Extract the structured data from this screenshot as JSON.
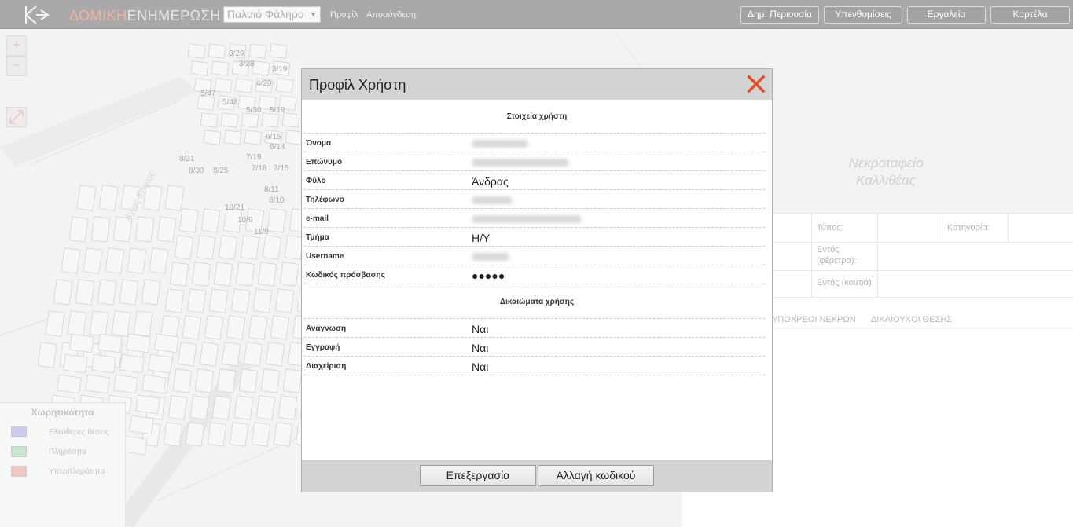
{
  "header": {
    "brand_part1": "ΔΟΜΙΚΗ",
    "brand_part2": "ΕΝΗΜΕΡΩΣΗ",
    "location_selected": "Παλαιό Φάληρο",
    "link_profile": "Προφίλ",
    "link_logout": "Αποσύνδεση",
    "buttons": [
      "Δημ. Περιουσία",
      "Υπενθυμίσεις",
      "Εργαλεία",
      "Καρτέλα"
    ]
  },
  "map": {
    "zoom_in": "+",
    "zoom_out": "−",
    "street_label": "Αγίας Σοφίας",
    "parcels": [
      "3/29",
      "3/28",
      "3/19",
      "4/20",
      "5/47",
      "5/42",
      "5/30",
      "5/19",
      "6/15",
      "6/14",
      "7/19",
      "7/18",
      "7/15",
      "8/31",
      "8/30",
      "8/25",
      "8/11",
      "8/10",
      "10/21",
      "10/9",
      "11/9"
    ],
    "legend": {
      "title": "Χωρητικότητα",
      "items": [
        {
          "label": "Ελεύθερες θέσεις",
          "color": "#c9c9f2"
        },
        {
          "label": "Πληρότητα",
          "color": "#c6e6cf"
        },
        {
          "label": "Υπερπληρότητα",
          "color": "#f3c6c6"
        }
      ]
    }
  },
  "right_panel": {
    "cemetery_label_line1": "Νεκροταφείο",
    "cemetery_label_line2": "Καλλιθέας",
    "type_label": "Τύπος:",
    "category_label": "Κατηγορία:",
    "inside_stretcher_line1": "Εντός",
    "inside_stretcher_line2": "(φέρετρα):",
    "inside_box": "Εντός (κουτιά):",
    "tab_obligated": "ΥΠΟΧΡΕΟΙ ΝΕΚΡΩΝ",
    "tab_beneficiaries": "ΔΙΚΑΙΟΥΧΟΙ ΘΕΣΗΣ"
  },
  "modal": {
    "title": "Προφίλ Χρήστη",
    "user_section_title": "Στοιχεία χρήστη",
    "fields": [
      {
        "label": "Όνομα",
        "value": "",
        "blurred": true
      },
      {
        "label": "Επώνυμο",
        "value": "",
        "blurred": true
      },
      {
        "label": "Φύλο",
        "value": "Άνδρας",
        "blurred": false
      },
      {
        "label": "Τηλέφωνο",
        "value": "",
        "blurred": true
      },
      {
        "label": "e-mail",
        "value": "",
        "blurred": true
      },
      {
        "label": "Τμήμα",
        "value": "Η/Υ",
        "blurred": false
      },
      {
        "label": "Username",
        "value": "",
        "blurred": true
      },
      {
        "label": "Κωδικός πρόσβασης",
        "value": "●●●●●",
        "blurred": false
      }
    ],
    "rights_section_title": "Δικαιώματα χρήσης",
    "rights": [
      {
        "label": "Ανάγνωση",
        "value": "Ναι"
      },
      {
        "label": "Εγγραφή",
        "value": "Ναι"
      },
      {
        "label": "Διαχείριση",
        "value": "Ναι"
      }
    ],
    "edit_button": "Επεξεργασία",
    "change_password_button": "Αλλαγή κωδικού"
  },
  "colors": {
    "close_x": "#e0502a",
    "topbar": "#a9a9a9",
    "modal_header": "#d3d3d3"
  }
}
